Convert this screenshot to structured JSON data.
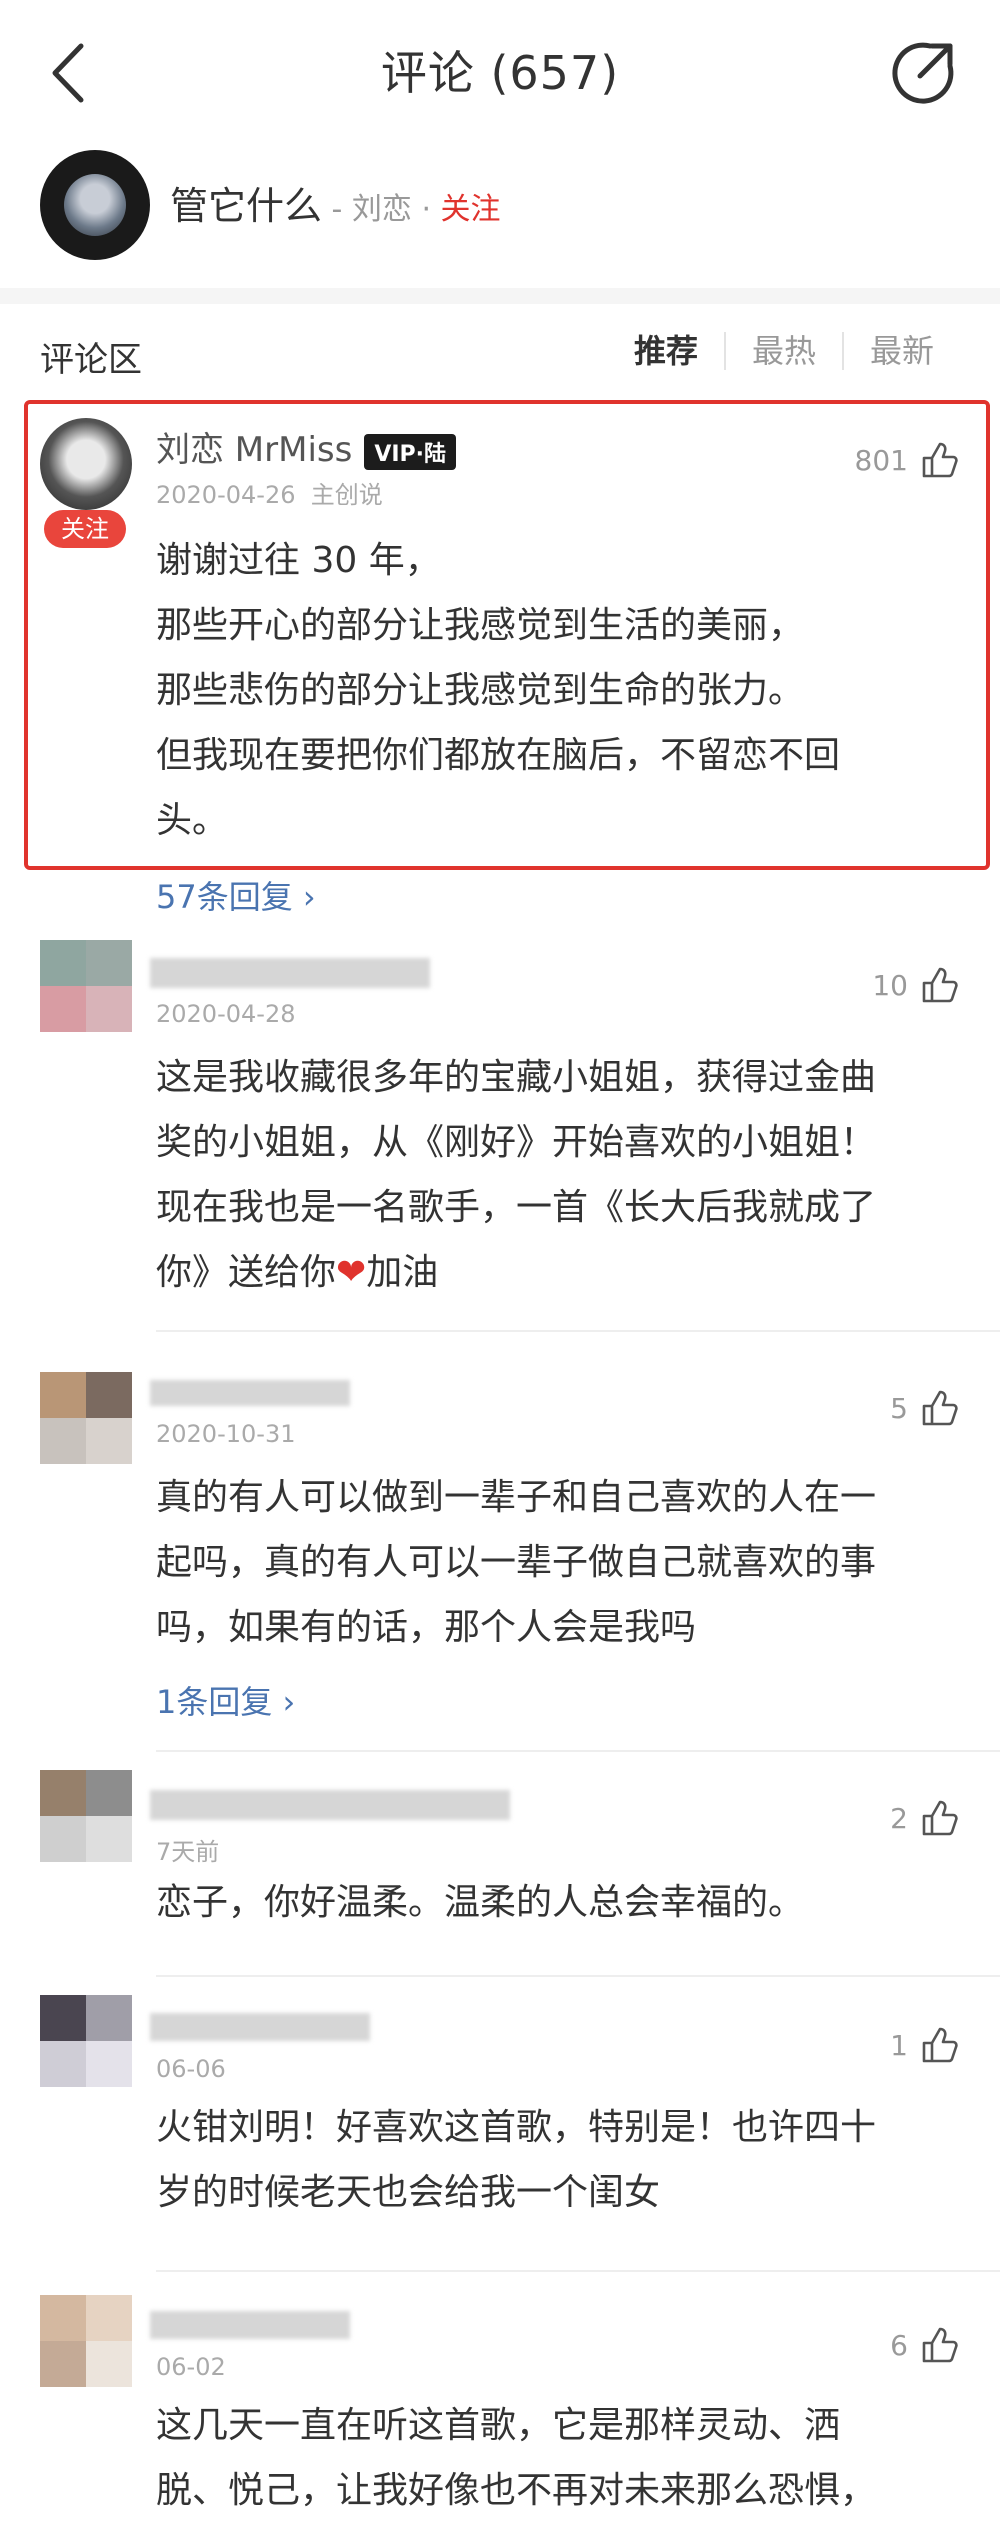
{
  "header": {
    "title": "评论 (657)"
  },
  "song": {
    "title": "管它什么",
    "artist_sep": " - 刘恋 · ",
    "follow_label": "关注"
  },
  "section": {
    "title": "评论区",
    "tabs": [
      "推荐",
      "最热",
      "最新"
    ],
    "active_tab": "推荐"
  },
  "comments": [
    {
      "user": "刘恋 MrMiss",
      "badge": "VIP·陆",
      "date": "2020-04-26",
      "role": "主创说",
      "likes": "801",
      "follow_tag": "关注",
      "lines": [
        "谢谢过往 30 年，",
        "那些开心的部分让我感觉到生活的美丽，",
        "那些悲伤的部分让我感觉到生命的张力。",
        "但我现在要把你们都放在脑后，不留恋不回",
        "头。"
      ],
      "replies": "57条回复 ›"
    },
    {
      "date": "2020-04-28",
      "likes": "10",
      "lines": [
        "这是我收藏很多年的宝藏小姐姐，获得过金曲",
        "奖的小姐姐，从《刚好》开始喜欢的小姐姐！",
        "现在我也是一名歌手，一首《长大后我就成了",
        "你》送给你"
      ],
      "heart_suffix": "加油"
    },
    {
      "date": "2020-10-31",
      "likes": "5",
      "lines": [
        "真的有人可以做到一辈子和自己喜欢的人在一",
        "起吗，真的有人可以一辈子做自己就喜欢的事",
        "吗，如果有的话，那个人会是我吗"
      ],
      "replies": "1条回复 ›"
    },
    {
      "date": "7天前",
      "likes": "2",
      "lines": [
        "恋子，你好温柔。温柔的人总会幸福的。"
      ]
    },
    {
      "date": "06-06",
      "likes": "1",
      "lines": [
        "火钳刘明！好喜欢这首歌，特别是！也许四十",
        "岁的时候老天也会给我一个闺女"
      ]
    },
    {
      "date": "06-02",
      "likes": "6",
      "lines": [
        "这几天一直在听这首歌，它是那样灵动、洒",
        "脱、悦己，让我好像也不再对未来那么恐惧，"
      ]
    }
  ]
}
